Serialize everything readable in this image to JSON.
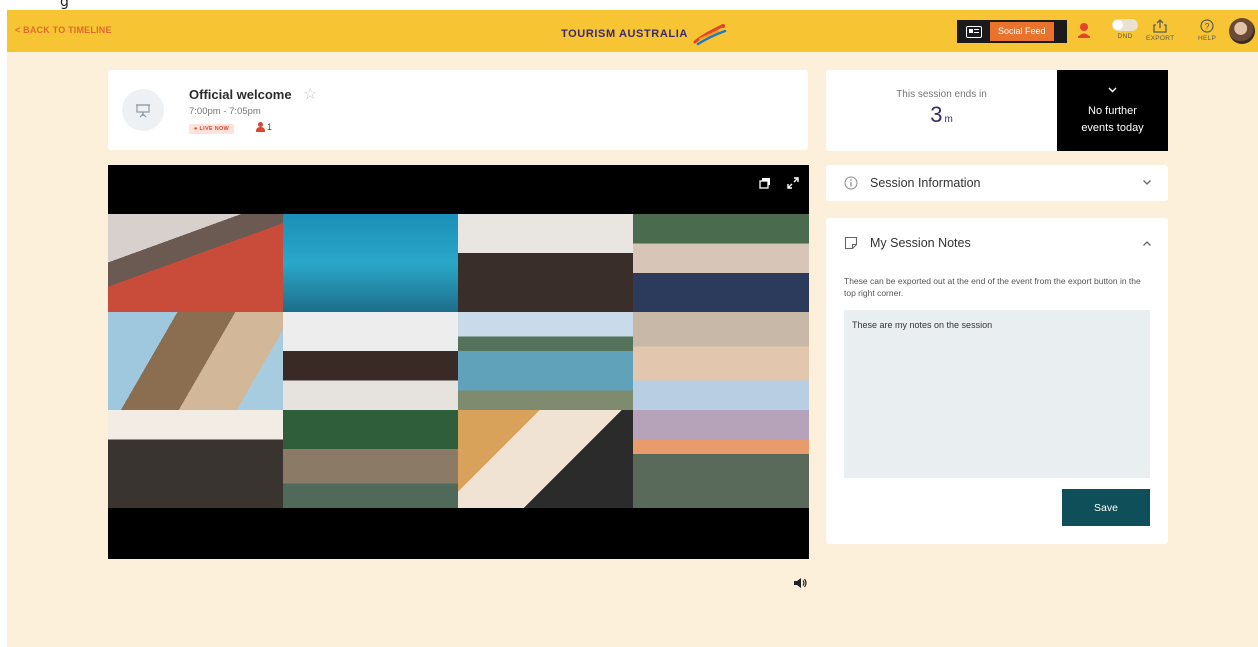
{
  "header": {
    "back_label": "< BACK TO TIMELINE",
    "brand": "TOURISM AUSTRALIA",
    "social_feed_label": "Social Feed",
    "dnd_label": "DND",
    "export_label": "EXPORT",
    "help_label": "HELP",
    "colors": {
      "bar": "#f7c533",
      "accent": "#e9722c"
    }
  },
  "session": {
    "title": "Official welcome",
    "time": "7:00pm - 7:05pm",
    "live_badge": "● LIVE NOW",
    "attendee_count": "1"
  },
  "timer": {
    "label": "This session ends in",
    "value": "3",
    "unit": "m"
  },
  "next_events": {
    "text_line1": "No further",
    "text_line2": "events today"
  },
  "session_info": {
    "title": "Session Information"
  },
  "notes": {
    "title": "My Session Notes",
    "description": "These can be exported out at the end of the event from the export button in the top right corner.",
    "value": "These are my notes on the session",
    "save_label": "Save"
  },
  "top_strip": {
    "text": "g"
  }
}
